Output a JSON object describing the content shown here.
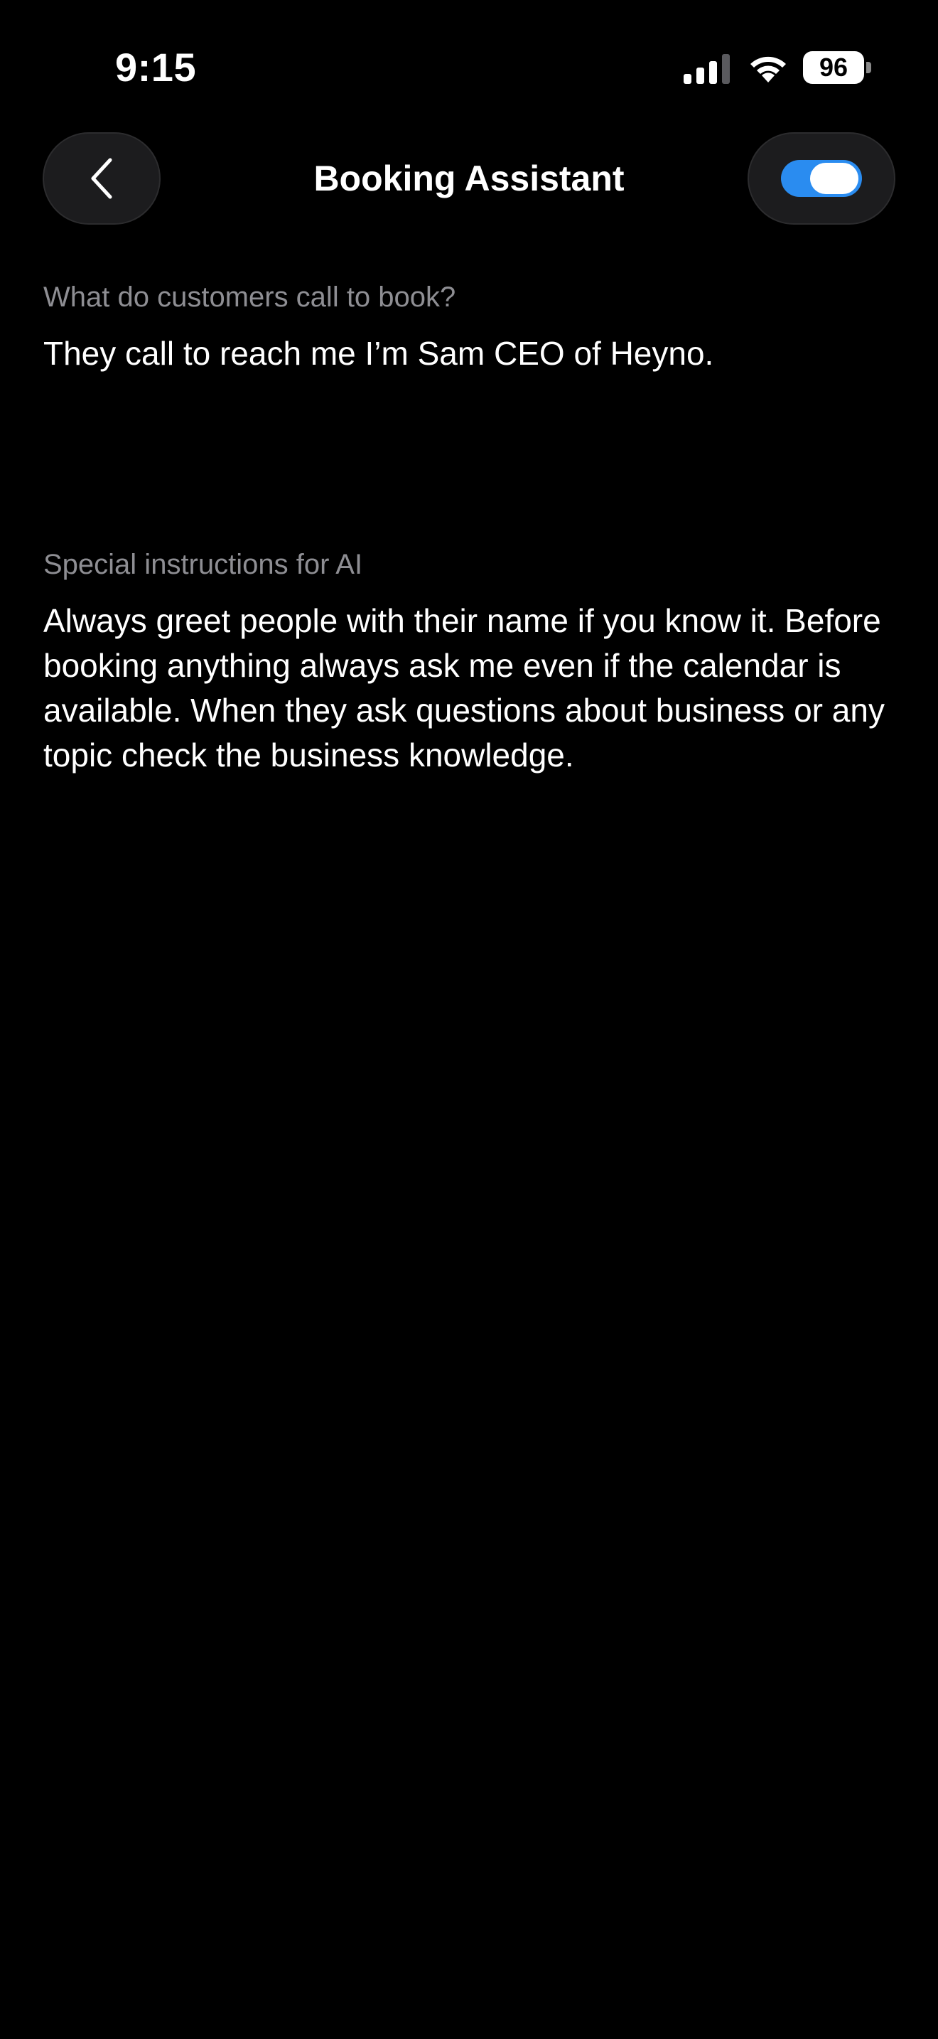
{
  "status_bar": {
    "time": "9:15",
    "battery_level": "96",
    "signal_icon": "cellular-signal-icon",
    "wifi_icon": "wifi-icon"
  },
  "header": {
    "back_icon": "chevron-left-icon",
    "title": "Booking Assistant",
    "toggle_on": true,
    "toggle_color": "#2A8CF0"
  },
  "fields": {
    "booking_reason": {
      "label": "What do customers call to book?",
      "value": "They call to reach me I’m Sam CEO of Heyno."
    },
    "special_instructions": {
      "label": "Special instructions for AI",
      "value": "Always greet people with their name if you know it. Before booking anything always ask me even if the calendar is available. When they ask questions about business or any topic check the business knowledge."
    }
  }
}
